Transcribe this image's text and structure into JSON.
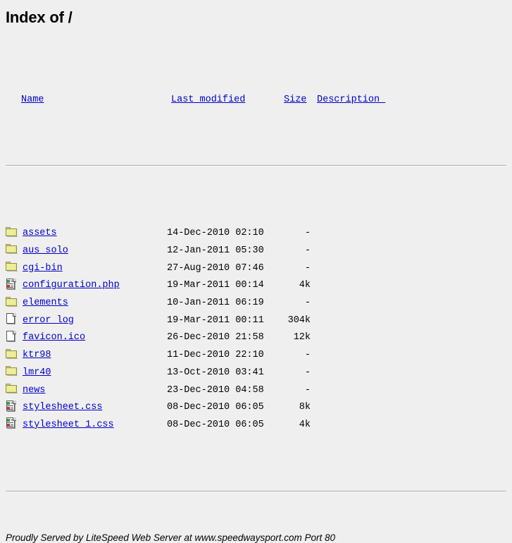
{
  "page": {
    "title": "Index of /",
    "background_color": "#efefef",
    "link_color": "#0000cc"
  },
  "table": {
    "headers": {
      "name": "Name",
      "last_modified": "Last modified",
      "size": "Size",
      "description": "Description "
    },
    "rows": [
      {
        "icon": "folder-icon",
        "name": "assets",
        "last_modified": "14-Dec-2010 02:10",
        "size": "-",
        "description": ""
      },
      {
        "icon": "folder-icon",
        "name": "aus_solo",
        "last_modified": "12-Jan-2011 05:30",
        "size": "-",
        "description": ""
      },
      {
        "icon": "folder-icon",
        "name": "cgi-bin",
        "last_modified": "27-Aug-2010 07:46",
        "size": "-",
        "description": ""
      },
      {
        "icon": "text-document-icon",
        "name": "configuration.php",
        "last_modified": "19-Mar-2011 00:14",
        "size": "4k",
        "description": ""
      },
      {
        "icon": "folder-icon",
        "name": "elements",
        "last_modified": "10-Jan-2011 06:19",
        "size": "-",
        "description": ""
      },
      {
        "icon": "document-icon",
        "name": "error_log",
        "last_modified": "19-Mar-2011 00:11",
        "size": "304k",
        "description": ""
      },
      {
        "icon": "document-icon",
        "name": "favicon.ico",
        "last_modified": "26-Dec-2010 21:58",
        "size": "12k",
        "description": ""
      },
      {
        "icon": "folder-icon",
        "name": "ktr98",
        "last_modified": "11-Dec-2010 22:10",
        "size": "-",
        "description": ""
      },
      {
        "icon": "folder-icon",
        "name": "lmr40",
        "last_modified": "13-Oct-2010 03:41",
        "size": "-",
        "description": ""
      },
      {
        "icon": "folder-icon",
        "name": "news",
        "last_modified": "23-Dec-2010 04:58",
        "size": "-",
        "description": ""
      },
      {
        "icon": "text-document-icon",
        "name": "stylesheet.css",
        "last_modified": "08-Dec-2010 06:05",
        "size": "8k",
        "description": ""
      },
      {
        "icon": "text-document-icon",
        "name": "stylesheet_1.css",
        "last_modified": "08-Dec-2010 06:05",
        "size": "4k",
        "description": ""
      }
    ]
  },
  "footer": {
    "text": "Proudly Served by LiteSpeed Web Server at www.speedwaysport.com Port 80"
  }
}
